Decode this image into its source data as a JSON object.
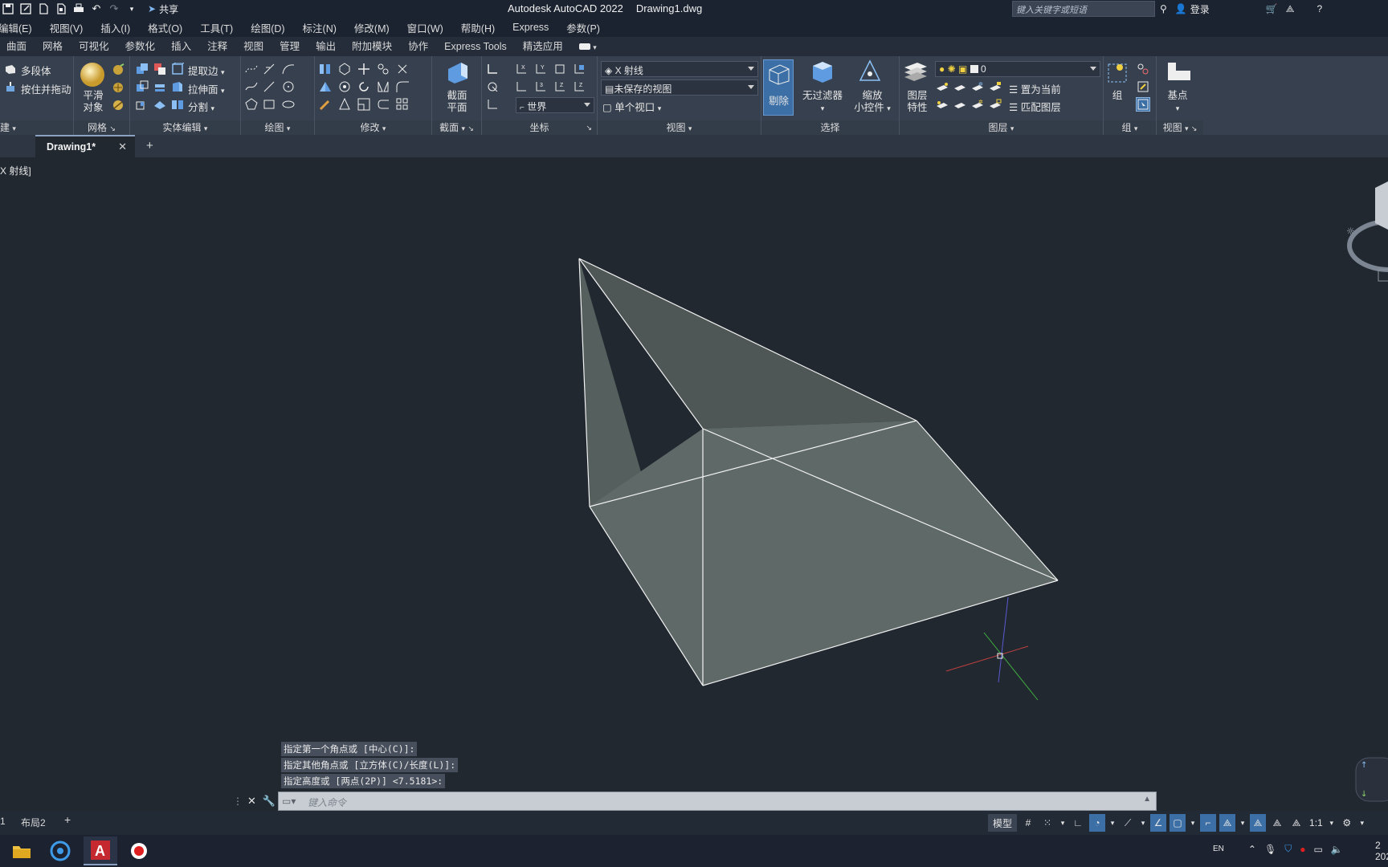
{
  "title_bar": {
    "app_title": "Autodesk AutoCAD 2022",
    "file_name": "Drawing1.dwg",
    "share_label": "共享",
    "search_placeholder": "键入关键字或短语",
    "login_label": "登录"
  },
  "menu": {
    "items": [
      "编辑(E)",
      "视图(V)",
      "插入(I)",
      "格式(O)",
      "工具(T)",
      "绘图(D)",
      "标注(N)",
      "修改(M)",
      "窗口(W)",
      "帮助(H)",
      "Express",
      "参数(P)"
    ]
  },
  "ribbon_tabs": [
    "曲面",
    "网格",
    "可视化",
    "参数化",
    "插入",
    "注释",
    "视图",
    "管理",
    "输出",
    "附加模块",
    "协作",
    "Express Tools",
    "精选应用"
  ],
  "ribbon": {
    "modeling": {
      "polysolid": "多段体",
      "presspull": "按住并拖动",
      "label": "建"
    },
    "mesh": {
      "smooth_line1": "平滑",
      "smooth_line2": "对象",
      "label": "网格"
    },
    "solid_edit": {
      "extract_edges": "提取边",
      "extrude_faces": "拉伸面",
      "separate": "分割",
      "label": "实体编辑"
    },
    "draw": {
      "label": "绘图"
    },
    "modify": {
      "label": "修改"
    },
    "section": {
      "plane_line1": "截面",
      "plane_line2": "平面",
      "label": "截面"
    },
    "coordinates": {
      "ucs_world": "世界",
      "label": "坐标"
    },
    "view": {
      "visual_style": "X 射线",
      "saved_view": "未保存的视图",
      "viewport_config": "单个视口",
      "label": "视图"
    },
    "selection": {
      "cull": "剔除",
      "no_filter": "无过滤器",
      "gizmo_line1": "缩放",
      "gizmo_line2": "小控件",
      "label": "选择"
    },
    "layers": {
      "layer_props_line1": "图层",
      "layer_props_line2": "特性",
      "current_layer": "0",
      "make_current": "置为当前",
      "match_layer": "匹配图层",
      "label": "图层"
    },
    "groups": {
      "group": "组",
      "label": "组"
    },
    "view2": {
      "base_point": "基点",
      "label": "视图"
    }
  },
  "doc_tabs": {
    "active": "Drawing1*"
  },
  "viewport": {
    "label": "X 射线]"
  },
  "command": {
    "history": [
      "指定第一个角点或 [中心(C)]:",
      "指定其他角点或 [立方体(C)/长度(L)]:",
      "指定高度或 [两点(2P)] <7.5181>:"
    ],
    "placeholder": "键入命令"
  },
  "layout_tabs": [
    "1",
    "布局2"
  ],
  "status": {
    "model": "模型",
    "scale": "1:1"
  },
  "tray": {
    "lang": "EN",
    "clock_year": "202",
    "clock_time": "2"
  },
  "colors": {
    "background": "#212830",
    "ribbon": "#37404e",
    "accent": "#3c6fa6",
    "solid_face": "#5f6968",
    "edge": "#f2f2f2"
  }
}
